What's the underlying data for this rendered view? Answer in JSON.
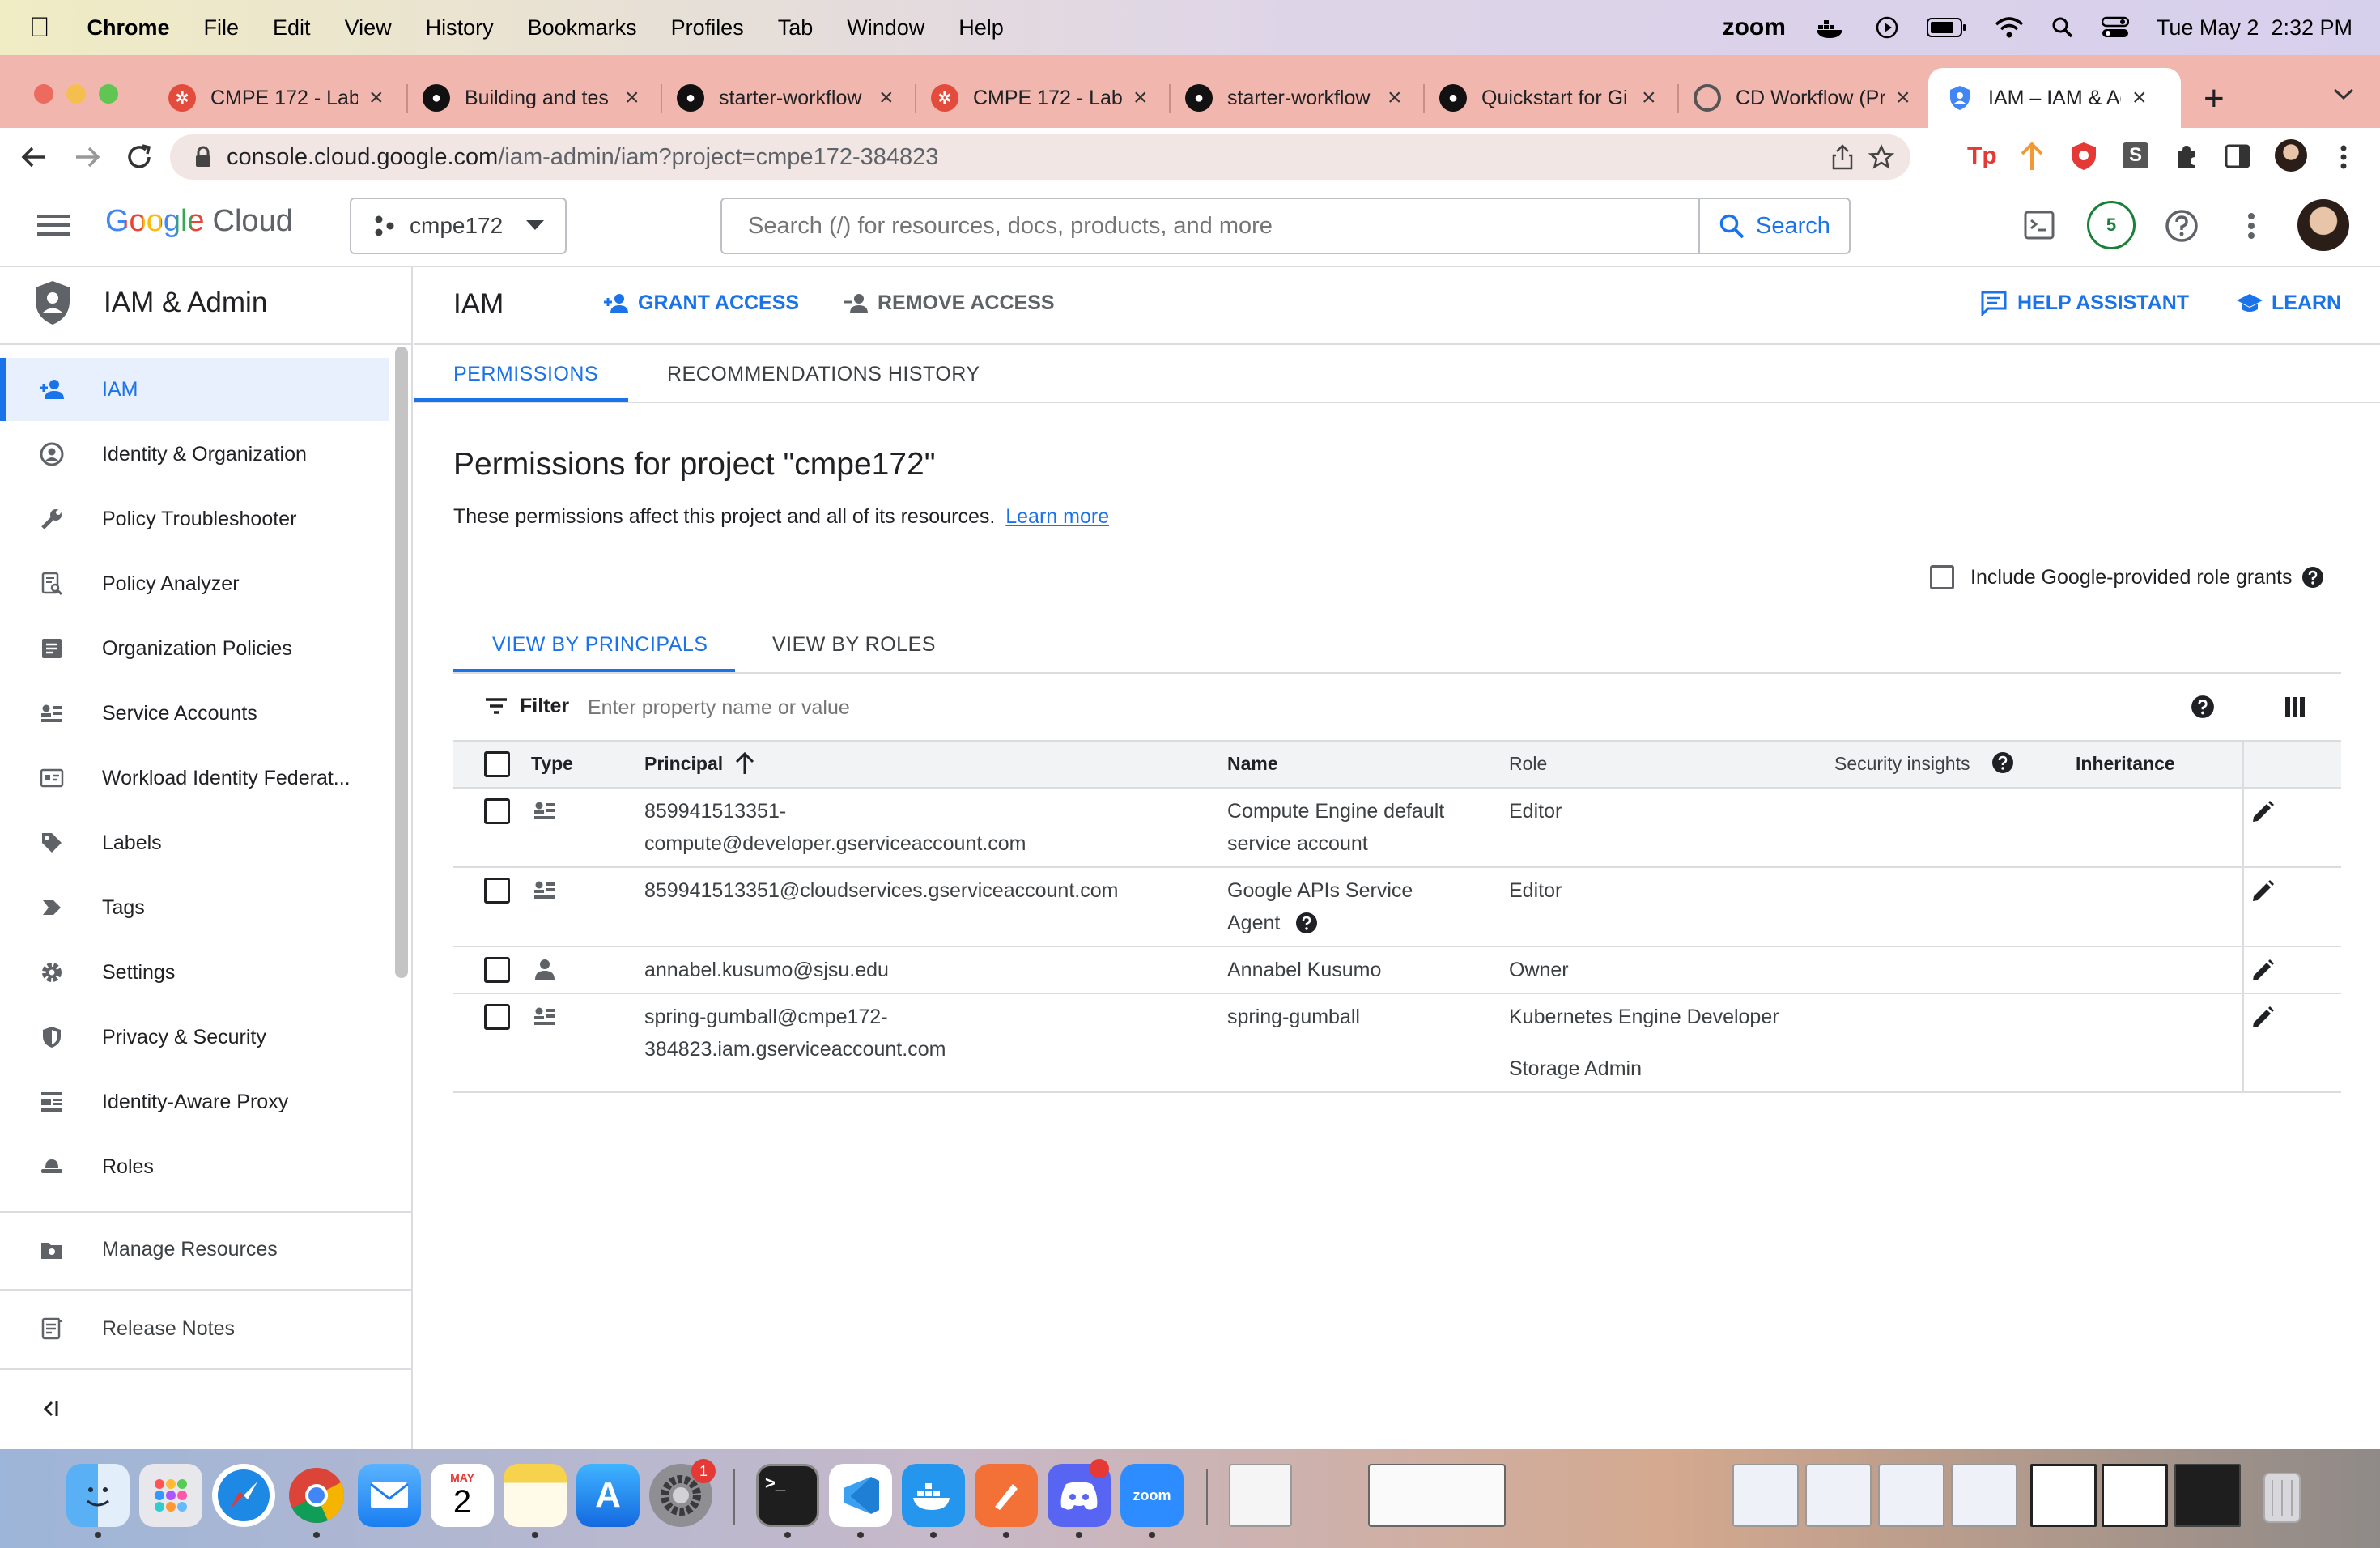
{
  "menubar": {
    "app": "Chrome",
    "items": [
      "File",
      "Edit",
      "View",
      "History",
      "Bookmarks",
      "Profiles",
      "Tab",
      "Window",
      "Help"
    ],
    "status_zoom": "zoom",
    "clock": "Tue May 2  2:32 PM"
  },
  "browser": {
    "tabs": [
      {
        "label": "CMPE 172 - Lab",
        "icon": "canvas-icon"
      },
      {
        "label": "Building and tes",
        "icon": "github-icon"
      },
      {
        "label": "starter-workflow",
        "icon": "github-icon"
      },
      {
        "label": "CMPE 172 - Lab",
        "icon": "canvas-icon"
      },
      {
        "label": "starter-workflow",
        "icon": "github-icon"
      },
      {
        "label": "Quickstart for Gi",
        "icon": "github-icon"
      },
      {
        "label": "CD Workflow (Pr",
        "icon": "workflow-icon"
      },
      {
        "label": "IAM – IAM & Adr",
        "icon": "shield-icon"
      }
    ],
    "url_host": "console.cloud.google.com",
    "url_path": "/iam-admin/iam?project=cmpe172-384823"
  },
  "gcp": {
    "logo_google": "Google",
    "logo_cloud": "Cloud",
    "project": "cmpe172",
    "search_placeholder": "Search (/) for resources, docs, products, and more",
    "search_button": "Search",
    "notification_count": "5"
  },
  "sidebar": {
    "title": "IAM & Admin",
    "items": [
      {
        "label": "IAM",
        "icon": "person-add-icon"
      },
      {
        "label": "Identity & Organization",
        "icon": "account-circle-icon"
      },
      {
        "label": "Policy Troubleshooter",
        "icon": "wrench-icon"
      },
      {
        "label": "Policy Analyzer",
        "icon": "document-search-icon"
      },
      {
        "label": "Organization Policies",
        "icon": "list-document-icon"
      },
      {
        "label": "Service Accounts",
        "icon": "service-account-icon"
      },
      {
        "label": "Workload Identity Federat...",
        "icon": "id-card-icon"
      },
      {
        "label": "Labels",
        "icon": "label-icon"
      },
      {
        "label": "Tags",
        "icon": "tag-icon"
      },
      {
        "label": "Settings",
        "icon": "gear-icon"
      },
      {
        "label": "Privacy & Security",
        "icon": "shield-icon"
      },
      {
        "label": "Identity-Aware Proxy",
        "icon": "proxy-icon"
      },
      {
        "label": "Roles",
        "icon": "hat-icon"
      }
    ],
    "manage_resources": "Manage Resources",
    "release_notes": "Release Notes"
  },
  "main": {
    "title": "IAM",
    "grant_access": "GRANT ACCESS",
    "remove_access": "REMOVE ACCESS",
    "help_assistant": "HELP ASSISTANT",
    "learn": "LEARN",
    "tab_permissions": "PERMISSIONS",
    "tab_recommendations": "RECOMMENDATIONS HISTORY",
    "heading": "Permissions for project \"cmpe172\"",
    "description": "These permissions affect this project and all of its resources.",
    "learn_more": "Learn more",
    "include_google_grants": "Include Google-provided role grants",
    "view_by_principals": "VIEW BY PRINCIPALS",
    "view_by_roles": "VIEW BY ROLES",
    "filter_label": "Filter",
    "filter_placeholder": "Enter property name or value"
  },
  "table": {
    "headers": {
      "type": "Type",
      "principal": "Principal",
      "name": "Name",
      "role": "Role",
      "security": "Security insights",
      "inheritance": "Inheritance"
    },
    "rows": [
      {
        "type": "service-account",
        "principal_1": "859941513351-",
        "principal_2": "compute@developer.gserviceaccount.com",
        "name_1": "Compute Engine default",
        "name_2": "service account",
        "role_1": "Editor",
        "role_2": ""
      },
      {
        "type": "service-account",
        "principal_1": "859941513351@cloudservices.gserviceaccount.com",
        "principal_2": "",
        "name_1": "Google APIs Service",
        "name_2": "Agent",
        "role_1": "Editor",
        "role_2": ""
      },
      {
        "type": "user",
        "principal_1": "annabel.kusumo@sjsu.edu",
        "principal_2": "",
        "name_1": "Annabel Kusumo",
        "name_2": "",
        "role_1": "Owner",
        "role_2": ""
      },
      {
        "type": "service-account",
        "principal_1": "spring-gumball@cmpe172-",
        "principal_2": "384823.iam.gserviceaccount.com",
        "name_1": "spring-gumball",
        "name_2": "",
        "role_1": "Kubernetes Engine Developer",
        "role_2": "Storage Admin"
      }
    ]
  },
  "dock": {
    "calendar_month": "MAY",
    "calendar_day": "2",
    "settings_badge": "1",
    "zoom_label": "zoom"
  },
  "colors": {
    "accent": "#1a73e8",
    "tabstrip": "#f1b7ae",
    "active_nav_bg": "#e8f0fe"
  }
}
